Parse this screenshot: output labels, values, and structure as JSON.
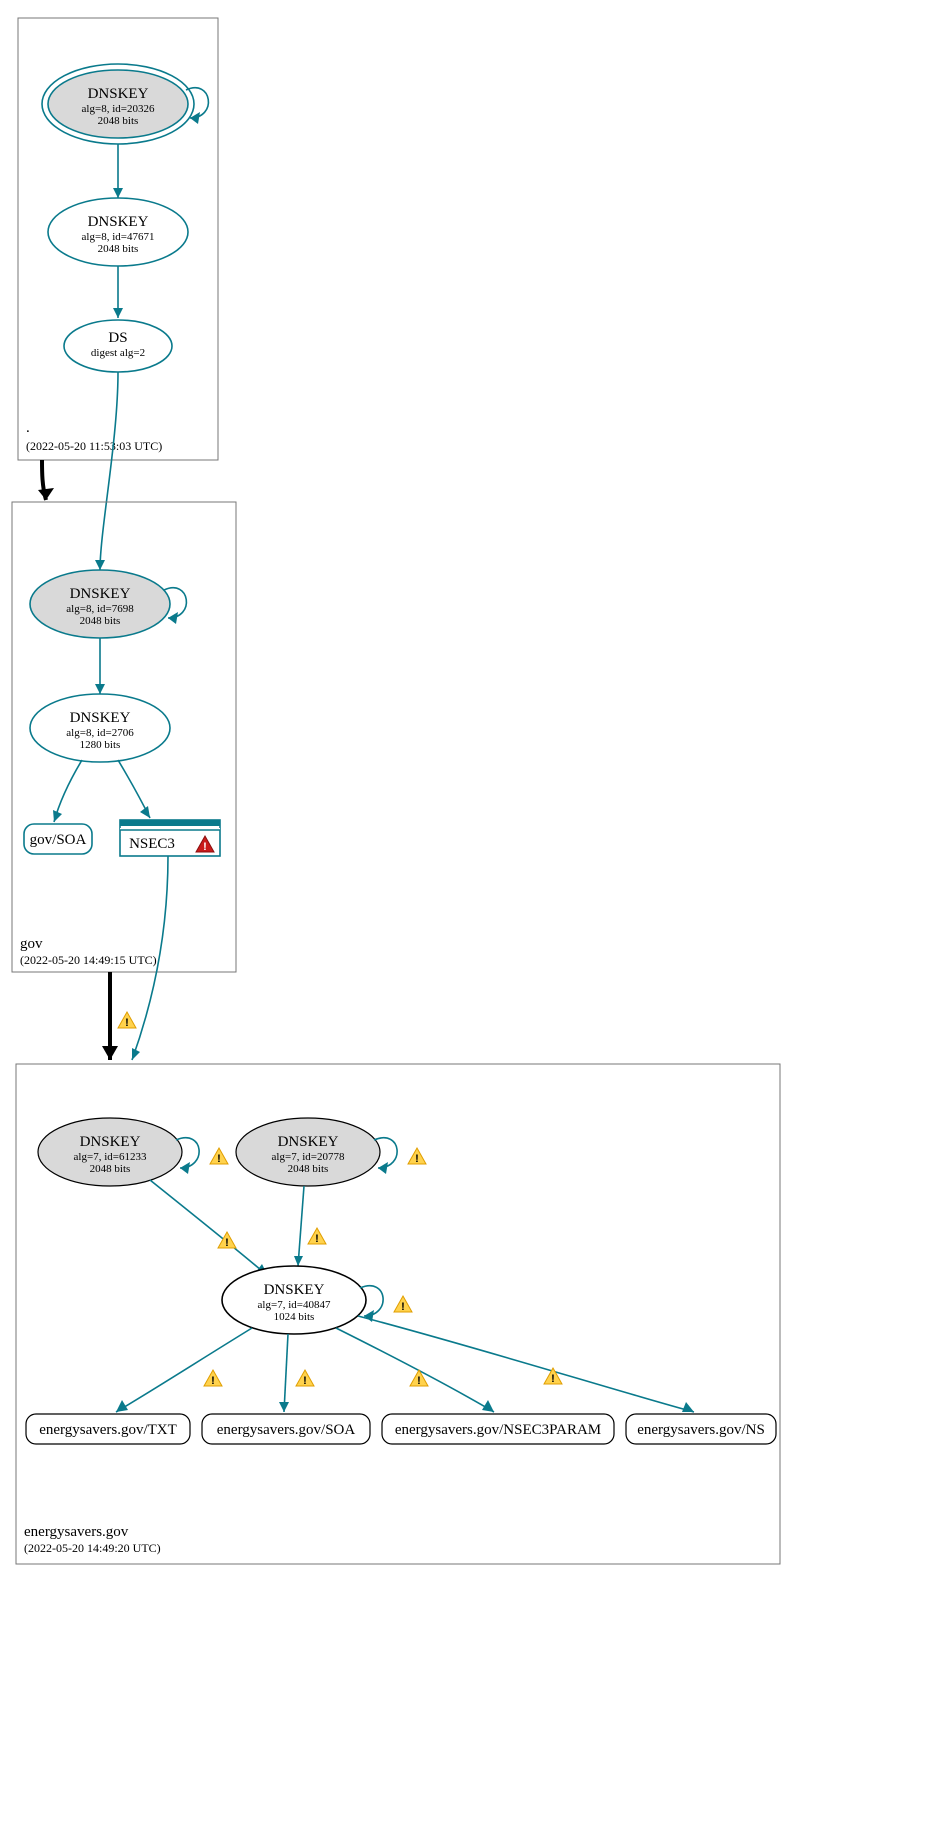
{
  "zones": {
    "root": {
      "label": ".",
      "timestamp": "(2022-05-20 11:53:03 UTC)"
    },
    "gov": {
      "label": "gov",
      "timestamp": "(2022-05-20 14:49:15 UTC)"
    },
    "es": {
      "label": "energysavers.gov",
      "timestamp": "(2022-05-20 14:49:20 UTC)"
    }
  },
  "nodes": {
    "root_ksk": {
      "title": "DNSKEY",
      "sub1": "alg=8, id=20326",
      "sub2": "2048 bits"
    },
    "root_zsk": {
      "title": "DNSKEY",
      "sub1": "alg=8, id=47671",
      "sub2": "2048 bits"
    },
    "root_ds": {
      "title": "DS",
      "sub1": "digest alg=2"
    },
    "gov_ksk": {
      "title": "DNSKEY",
      "sub1": "alg=8, id=7698",
      "sub2": "2048 bits"
    },
    "gov_zsk": {
      "title": "DNSKEY",
      "sub1": "alg=8, id=2706",
      "sub2": "1280 bits"
    },
    "gov_soa": {
      "title": "gov/SOA"
    },
    "gov_nsec3": {
      "title": "NSEC3"
    },
    "es_ksk1": {
      "title": "DNSKEY",
      "sub1": "alg=7, id=61233",
      "sub2": "2048 bits"
    },
    "es_ksk2": {
      "title": "DNSKEY",
      "sub1": "alg=7, id=20778",
      "sub2": "2048 bits"
    },
    "es_zsk": {
      "title": "DNSKEY",
      "sub1": "alg=7, id=40847",
      "sub2": "1024 bits"
    },
    "es_txt": {
      "title": "energysavers.gov/TXT"
    },
    "es_soa": {
      "title": "energysavers.gov/SOA"
    },
    "es_n3p": {
      "title": "energysavers.gov/NSEC3PARAM"
    },
    "es_ns": {
      "title": "energysavers.gov/NS"
    }
  }
}
